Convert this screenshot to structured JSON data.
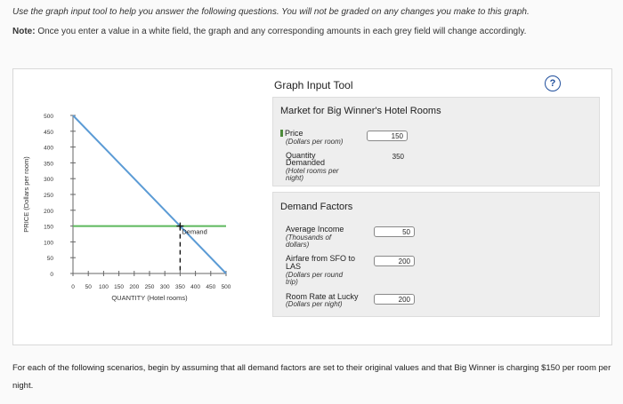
{
  "instruction": "Use the graph input tool to help you answer the following questions. You will not be graded on any changes you make to this graph.",
  "note": {
    "label": "Note:",
    "text": "Once you enter a value in a white field, the graph and any corresponding amounts in each grey field will change accordingly."
  },
  "tool": {
    "title": "Graph Input Tool",
    "help": "?"
  },
  "market": {
    "title": "Market for Big Winner's Hotel Rooms",
    "price_label": "Price",
    "price_sub": "(Dollars per room)",
    "price_value": "150",
    "qty_label_1": "Quantity",
    "qty_label_2": "Demanded",
    "qty_sub_1": "(Hotel rooms per",
    "qty_sub_2": "night)",
    "qty_value": "350"
  },
  "demand_factors": {
    "title": "Demand Factors",
    "income_label": "Average Income",
    "income_sub_1": "(Thousands of",
    "income_sub_2": "dollars)",
    "income_value": "50",
    "airfare_label_1": "Airfare from SFO to",
    "airfare_label_2": "LAS",
    "airfare_sub_1": "(Dollars per round",
    "airfare_sub_2": "trip)",
    "airfare_value": "200",
    "room_rate_label": "Room Rate at Lucky",
    "room_rate_sub": "(Dollars per night)",
    "room_rate_value": "200"
  },
  "chart_data": {
    "type": "line",
    "ylabel": "PRICE (Dollars per room)",
    "xlabel": "QUANTITY (Hotel rooms)",
    "x_ticks": [
      "0",
      "50",
      "100",
      "150",
      "200",
      "250",
      "300",
      "350",
      "400",
      "450",
      "500"
    ],
    "y_ticks": [
      "0",
      "50",
      "100",
      "150",
      "200",
      "250",
      "300",
      "350",
      "400",
      "450",
      "500"
    ],
    "xlim": [
      0,
      500
    ],
    "ylim": [
      0,
      500
    ],
    "series": [
      {
        "name": "Demand",
        "x": [
          0,
          500
        ],
        "y": [
          500,
          0
        ],
        "color": "#5b9bd5"
      }
    ],
    "price_line": {
      "y": 150,
      "color": "#5cb85c"
    },
    "point": {
      "x": 350,
      "y": 150
    },
    "point_label": "Demand"
  },
  "scenario_text": "For each of the following scenarios, begin by assuming that all demand factors are set to their original values and that Big Winner is charging $150 per room per night."
}
